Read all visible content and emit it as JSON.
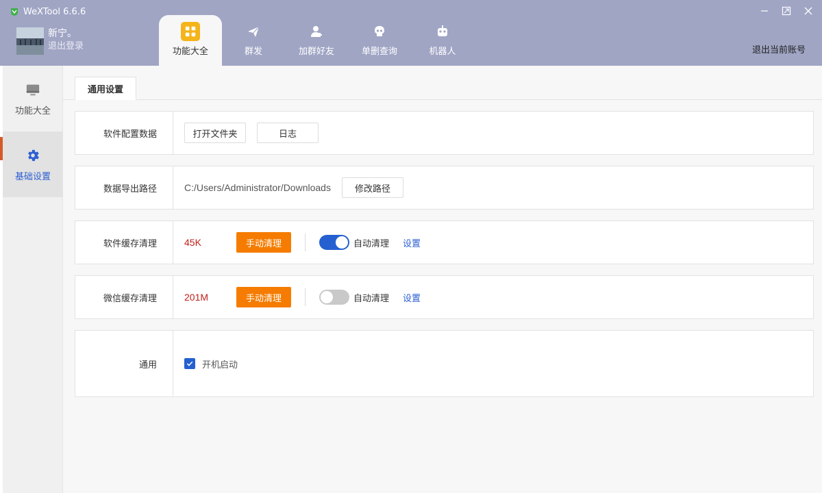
{
  "app": {
    "title": "WeXTool 6.6.6"
  },
  "user": {
    "name": "新宁。",
    "logout_label": "退出登录"
  },
  "nav": {
    "tabs": [
      {
        "label": "功能大全",
        "icon": "grid-icon",
        "active": true
      },
      {
        "label": "群发",
        "icon": "paper-plane-icon",
        "active": false
      },
      {
        "label": "加群好友",
        "icon": "add-user-icon",
        "active": false
      },
      {
        "label": "单删查询",
        "icon": "skull-icon",
        "active": false
      },
      {
        "label": "机器人",
        "icon": "robot-icon",
        "active": false
      }
    ],
    "switch_account_label": "退出当前账号"
  },
  "sidebar": {
    "items": [
      {
        "label": "功能大全",
        "icon": "monitor-icon",
        "active": false
      },
      {
        "label": "基础设置",
        "icon": "gear-icon",
        "active": true
      }
    ]
  },
  "content": {
    "tab_label": "通用设置",
    "config": {
      "label": "软件配置数据",
      "open_folder_label": "打开文件夹",
      "log_label": "日志"
    },
    "export": {
      "label": "数据导出路径",
      "path": "C:/Users/Administrator/Downloads",
      "modify_label": "修改路径"
    },
    "software_cache": {
      "label": "软件缓存清理",
      "size": "45K",
      "clean_label": "手动清理",
      "auto_label": "自动清理",
      "auto_on": true,
      "settings_label": "设置"
    },
    "wechat_cache": {
      "label": "微信缓存清理",
      "size": "201M",
      "clean_label": "手动清理",
      "auto_label": "自动清理",
      "auto_on": false,
      "settings_label": "设置"
    },
    "general": {
      "label": "通用",
      "startup_label": "开机启动",
      "startup_checked": true
    }
  },
  "colors": {
    "header": "#a0a5c4",
    "accent_blue": "#2460d0",
    "orange": "#f57c00",
    "size_red": "#c0211a",
    "active_nav_icon": "#f4b41a"
  }
}
